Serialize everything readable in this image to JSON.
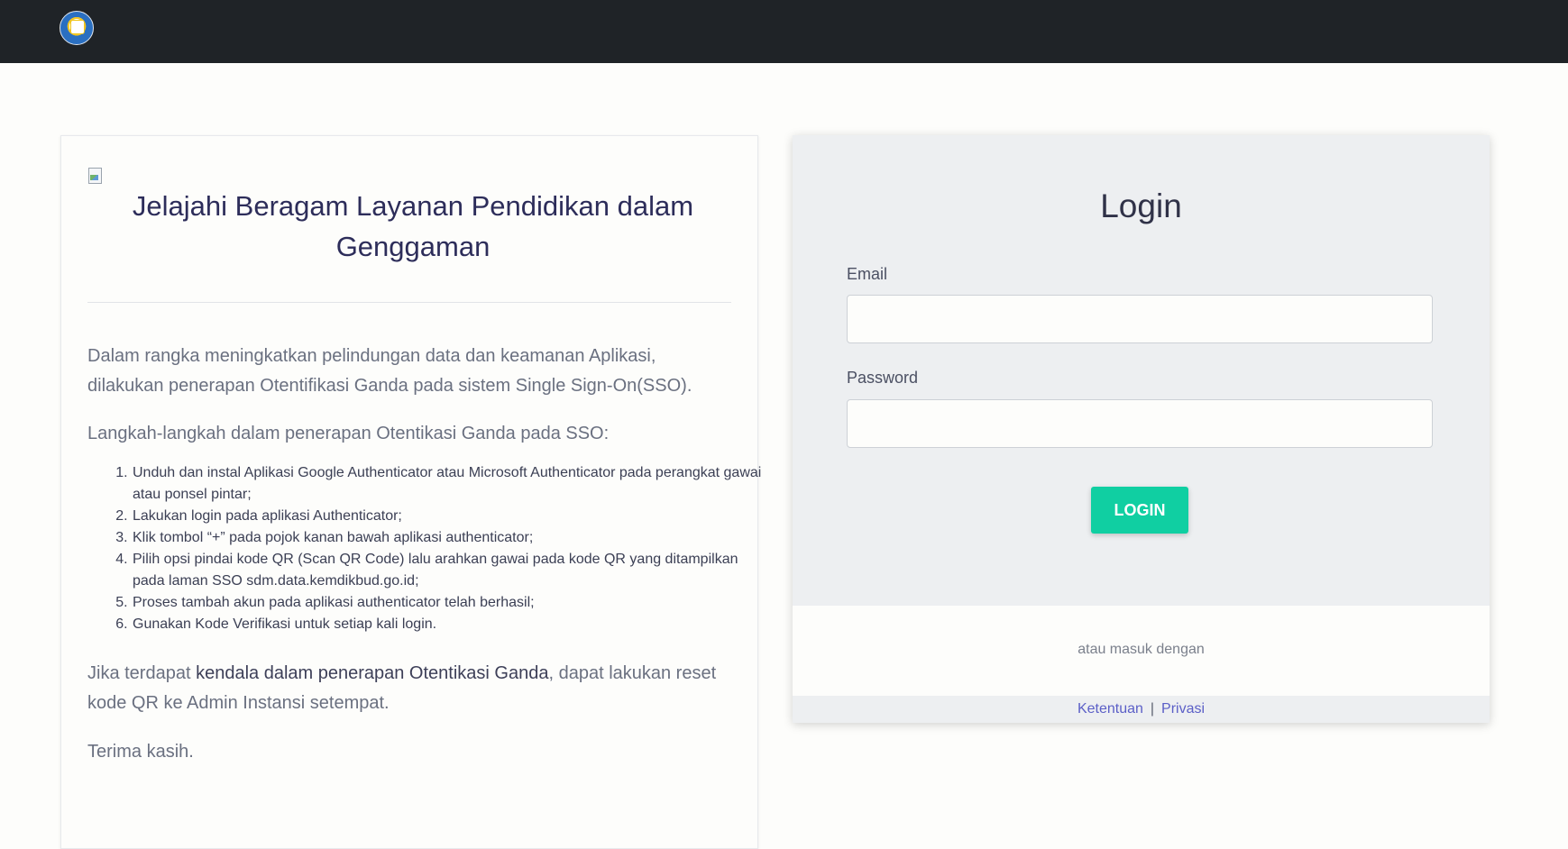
{
  "header": {
    "logo_icon": "kemdikbud-logo-icon"
  },
  "info_card": {
    "image_icon": "broken-image-icon",
    "title": "Jelajahi Beragam Layanan Pendidikan dalam Genggaman",
    "intro": "Dalam rangka meningkatkan pelindungan data dan keamanan Aplikasi, dilakukan penerapan Otentifikasi Ganda pada sistem Single Sign-On(SSO).",
    "steps_heading": "Langkah-langkah dalam penerapan Otentikasi Ganda pada SSO:",
    "steps": [
      "Unduh dan instal Aplikasi Google Authenticator atau Microsoft Authenticator pada perangkat gawai atau ponsel pintar;",
      "Lakukan login pada aplikasi Authenticator;",
      "Klik tombol “+” pada pojok kanan bawah aplikasi authenticator;",
      "Pilih opsi pindai kode QR (Scan QR Code) lalu arahkan gawai pada kode QR yang ditampilkan pada laman SSO sdm.data.kemdikbud.go.id;",
      "Proses tambah akun pada aplikasi authenticator telah berhasil;",
      "Gunakan Kode Verifikasi untuk setiap kali login."
    ],
    "issue_prefix": "Jika terdapat ",
    "issue_emphasis": "kendala dalam penerapan Otentikasi Ganda",
    "issue_suffix": ", dapat lakukan reset kode QR ke Admin Instansi setempat.",
    "thanks": "Terima kasih."
  },
  "login_card": {
    "title": "Login",
    "email_label": "Email",
    "email_value": "",
    "password_label": "Password",
    "password_value": "",
    "login_button": "LOGIN",
    "alt_login_text": "atau masuk dengan",
    "footer": {
      "terms": "Ketentuan",
      "separator": "|",
      "privacy": "Privasi"
    }
  },
  "colors": {
    "topbar": "#1f2327",
    "accent_button": "#10cfa2",
    "link": "#5b5fc7"
  }
}
